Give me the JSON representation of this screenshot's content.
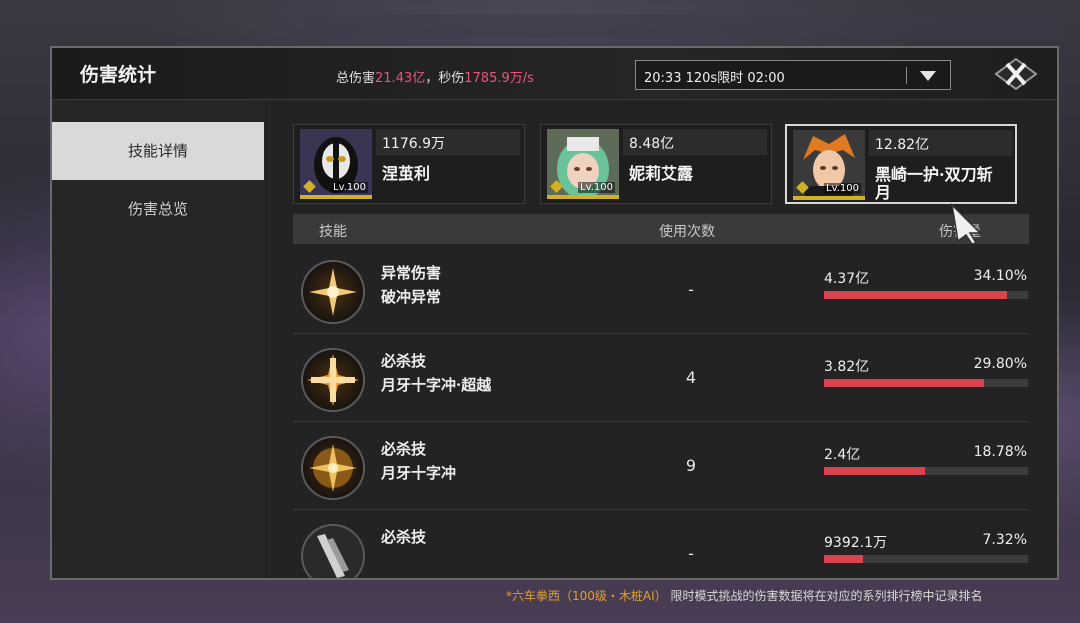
{
  "header": {
    "title": "伤害统计",
    "total_label": "总伤害",
    "total_value": "21.43亿",
    "sep": "，",
    "dps_label": "秒伤",
    "dps_value": "1785.9万/s",
    "dropdown_value": "20:33 120s限时 02:00"
  },
  "sidebar": {
    "items": [
      {
        "label": "技能详情",
        "active": true
      },
      {
        "label": "伤害总览",
        "active": false
      }
    ]
  },
  "characters": [
    {
      "damage": "1176.9万",
      "name": "涅茧利",
      "level": "Lv.100",
      "selected": false
    },
    {
      "damage": "8.48亿",
      "name": "妮莉艾露",
      "level": "Lv.100",
      "selected": false
    },
    {
      "damage": "12.82亿",
      "name": "黑崎一护·双刀斩月",
      "level": "Lv.100",
      "selected": true
    }
  ],
  "table": {
    "col_skill": "技能",
    "col_uses": "使用次数",
    "col_damage": "伤害量",
    "rows": [
      {
        "type": "异常伤害",
        "name": "破冲异常",
        "uses": "-",
        "damage": "4.37亿",
        "percent": "34.10%",
        "fraction": 0.341
      },
      {
        "type": "必杀技",
        "name": "月牙十字冲·超越",
        "uses": "4",
        "damage": "3.82亿",
        "percent": "29.80%",
        "fraction": 0.298
      },
      {
        "type": "必杀技",
        "name": "月牙十字冲",
        "uses": "9",
        "damage": "2.4亿",
        "percent": "18.78%",
        "fraction": 0.1878
      },
      {
        "type": "必杀技",
        "name": "",
        "uses": "-",
        "damage": "9392.1万",
        "percent": "7.32%",
        "fraction": 0.0732
      }
    ]
  },
  "footer": {
    "prefix": "*",
    "highlight": "六车拳西（100级・木桩AI）",
    "text": "限时模式挑战的伤害数据将在对应的系列排行榜中记录排名"
  },
  "colors": {
    "accent_pink": "#e8577a",
    "bar_red": "#d9434f",
    "level_gold": "#d4b023",
    "footer_gold": "#e0a030"
  },
  "icons": {
    "close": "close-x-icon",
    "dropdown": "chevron-down-icon",
    "skill_star": "starburst-icon",
    "skill_blade": "blade-icon"
  }
}
